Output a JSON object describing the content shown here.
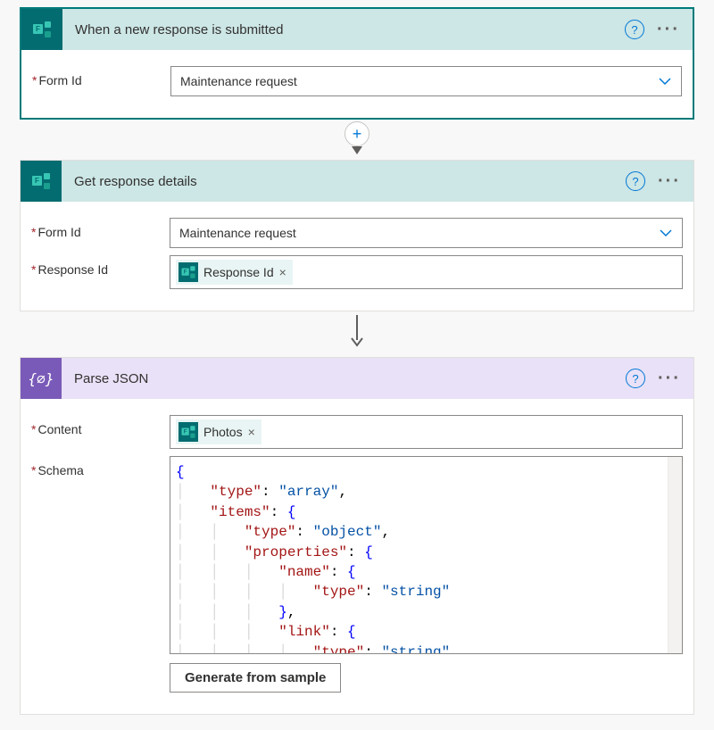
{
  "card1": {
    "title": "When a new response is submitted",
    "formIdLabel": "Form Id",
    "formIdValue": "Maintenance request"
  },
  "card2": {
    "title": "Get response details",
    "formIdLabel": "Form Id",
    "formIdValue": "Maintenance request",
    "responseIdLabel": "Response Id",
    "responseToken": "Response Id"
  },
  "card3": {
    "title": "Parse JSON",
    "contentLabel": "Content",
    "contentToken": "Photos",
    "schemaLabel": "Schema",
    "generateBtn": "Generate from sample"
  },
  "schema": {
    "l1": "{",
    "l2_k": "\"type\"",
    "l2_v": "\"array\"",
    "l3_k": "\"items\"",
    "l4_k": "\"type\"",
    "l4_v": "\"object\"",
    "l5_k": "\"properties\"",
    "l6_k": "\"name\"",
    "l7_k": "\"type\"",
    "l7_v": "\"string\"",
    "l8_k": "\"link\"",
    "l9_k": "\"type\"",
    "l9_v": "\"string\""
  },
  "icons": {
    "help": "?",
    "more": "···",
    "close": "×",
    "plus": "+",
    "formsF": "F",
    "jsonBraces": "{∅}"
  }
}
